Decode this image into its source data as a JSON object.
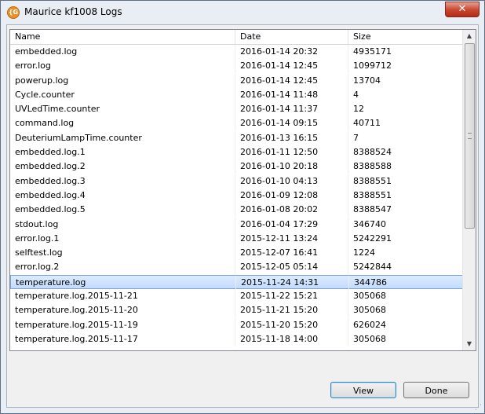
{
  "window": {
    "title": "Maurice kf1008 Logs",
    "app_icon_glyph": "{G",
    "close_glyph": "✕"
  },
  "table": {
    "columns": [
      "Name",
      "Date",
      "Size"
    ],
    "rows": [
      {
        "name": "embedded.log",
        "date": "2016-01-14 20:32",
        "size": "4935171"
      },
      {
        "name": "error.log",
        "date": "2016-01-14 12:45",
        "size": "1099712"
      },
      {
        "name": "powerup.log",
        "date": "2016-01-14 12:45",
        "size": "13704"
      },
      {
        "name": "Cycle.counter",
        "date": "2016-01-14 11:48",
        "size": "4"
      },
      {
        "name": "UVLedTime.counter",
        "date": "2016-01-14 11:37",
        "size": "12"
      },
      {
        "name": "command.log",
        "date": "2016-01-14 09:15",
        "size": "40711"
      },
      {
        "name": "DeuteriumLampTime.counter",
        "date": "2016-01-13 16:15",
        "size": "7"
      },
      {
        "name": "embedded.log.1",
        "date": "2016-01-11 12:50",
        "size": "8388524"
      },
      {
        "name": "embedded.log.2",
        "date": "2016-01-10 20:18",
        "size": "8388588"
      },
      {
        "name": "embedded.log.3",
        "date": "2016-01-10 04:13",
        "size": "8388551"
      },
      {
        "name": "embedded.log.4",
        "date": "2016-01-09 12:08",
        "size": "8388551"
      },
      {
        "name": "embedded.log.5",
        "date": "2016-01-08 20:02",
        "size": "8388547"
      },
      {
        "name": "stdout.log",
        "date": "2016-01-04 17:29",
        "size": "346740"
      },
      {
        "name": "error.log.1",
        "date": "2015-12-11 13:24",
        "size": "5242291"
      },
      {
        "name": "selftest.log",
        "date": "2015-12-07 16:41",
        "size": "1224"
      },
      {
        "name": "error.log.2",
        "date": "2015-12-05 05:14",
        "size": "5242844"
      },
      {
        "name": "temperature.log",
        "date": "2015-11-24 14:31",
        "size": "344786",
        "selected": true
      },
      {
        "name": "temperature.log.2015-11-21",
        "date": "2015-11-22 15:21",
        "size": "305068"
      },
      {
        "name": "temperature.log.2015-11-20",
        "date": "2015-11-21 15:20",
        "size": "305068"
      },
      {
        "name": "temperature.log.2015-11-19",
        "date": "2015-11-20 15:20",
        "size": "626024"
      },
      {
        "name": "temperature.log.2015-11-17",
        "date": "2015-11-18 14:00",
        "size": "305068"
      }
    ]
  },
  "scrollbar": {
    "up_glyph": "▲",
    "down_glyph": "▼"
  },
  "buttons": {
    "view": "View",
    "done": "Done"
  }
}
